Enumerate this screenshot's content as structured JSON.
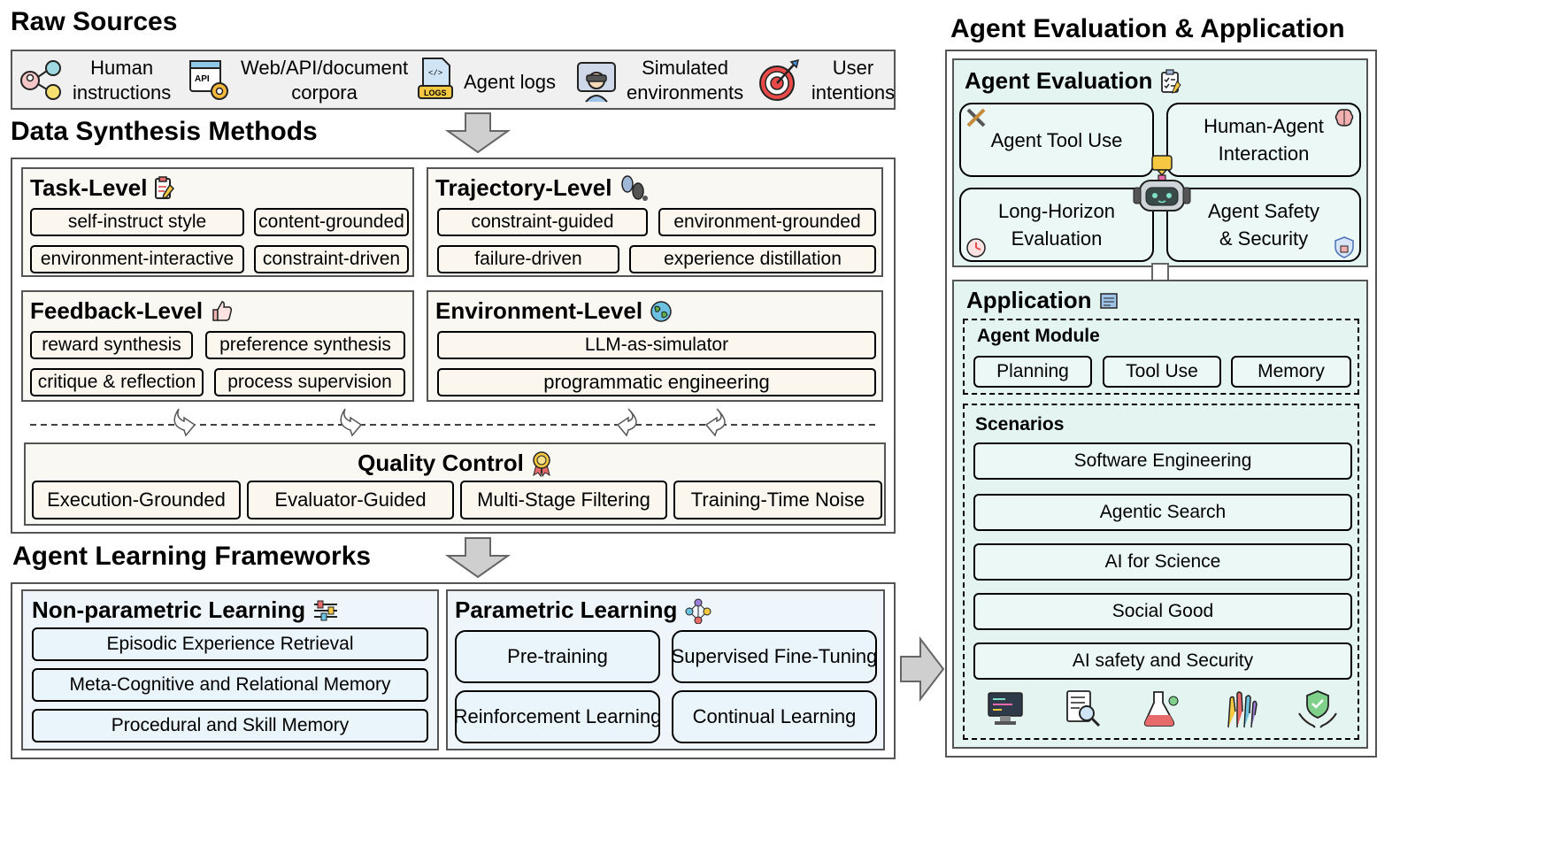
{
  "raw_sources": {
    "title": "Raw Sources",
    "items": [
      {
        "label_line1": "Human",
        "label_line2": "instructions",
        "icon": "human-network-icon"
      },
      {
        "label_line1": "Web/API/document",
        "label_line2": "corpora",
        "icon": "api-gear-icon"
      },
      {
        "label_line1": "Agent logs",
        "label_line2": "",
        "icon": "logs-file-icon"
      },
      {
        "label_line1": "Simulated",
        "label_line2": "environments",
        "icon": "vr-headset-icon"
      },
      {
        "label_line1": "User",
        "label_line2": "intentions",
        "icon": "target-icon"
      }
    ]
  },
  "data_synthesis": {
    "title": "Data Synthesis Methods",
    "task_level": {
      "title": "Task-Level",
      "items": [
        "self-instruct style",
        "content-grounded",
        "environment-interactive",
        "constraint-driven"
      ]
    },
    "trajectory_level": {
      "title": "Trajectory-Level",
      "items": [
        "constraint-guided",
        "environment-grounded",
        "failure-driven",
        "experience distillation"
      ]
    },
    "feedback_level": {
      "title": "Feedback-Level",
      "items": [
        "reward synthesis",
        "preference synthesis",
        "critique & reflection",
        "process supervision"
      ]
    },
    "environment_level": {
      "title": "Environment-Level",
      "items": [
        "LLM-as-simulator",
        "programmatic engineering"
      ]
    },
    "quality_control": {
      "title": "Quality Control",
      "items": [
        "Execution-Grounded",
        "Evaluator-Guided",
        "Multi-Stage Filtering",
        "Training-Time Noise"
      ]
    }
  },
  "learning": {
    "title": "Agent Learning Frameworks",
    "non_parametric": {
      "title": "Non-parametric Learning",
      "items": [
        "Episodic Experience Retrieval",
        "Meta-Cognitive and Relational Memory",
        "Procedural and Skill Memory"
      ]
    },
    "parametric": {
      "title": "Parametric Learning",
      "items": [
        "Pre-training",
        "Supervised Fine-Tuning",
        "Reinforcement Learning",
        "Continual Learning"
      ]
    }
  },
  "evaluation_application": {
    "title": "Agent Evaluation & Application",
    "evaluation": {
      "title": "Agent Evaluation",
      "items": [
        {
          "line1": "Agent Tool Use",
          "line2": ""
        },
        {
          "line1": "Human-Agent",
          "line2": "Interaction"
        },
        {
          "line1": "Long-Horizon",
          "line2": "Evaluation"
        },
        {
          "line1": "Agent Safety",
          "line2": "& Security"
        }
      ]
    },
    "application": {
      "title": "Application",
      "agent_module": {
        "title": "Agent Module",
        "items": [
          "Planning",
          "Tool Use",
          "Memory"
        ]
      },
      "scenarios": {
        "title": "Scenarios",
        "items": [
          "Software Engineering",
          "Agentic Search",
          "AI for Science",
          "Social Good",
          "AI safety and Security"
        ],
        "icons": [
          "computer-code-icon",
          "document-search-icon",
          "flask-icon",
          "raised-hands-icon",
          "shield-hands-icon"
        ]
      }
    }
  },
  "colors": {
    "beige": "#faf8f2",
    "blue": "#eaf4fb",
    "mint": "#ecf8f5",
    "border": "#555555"
  }
}
